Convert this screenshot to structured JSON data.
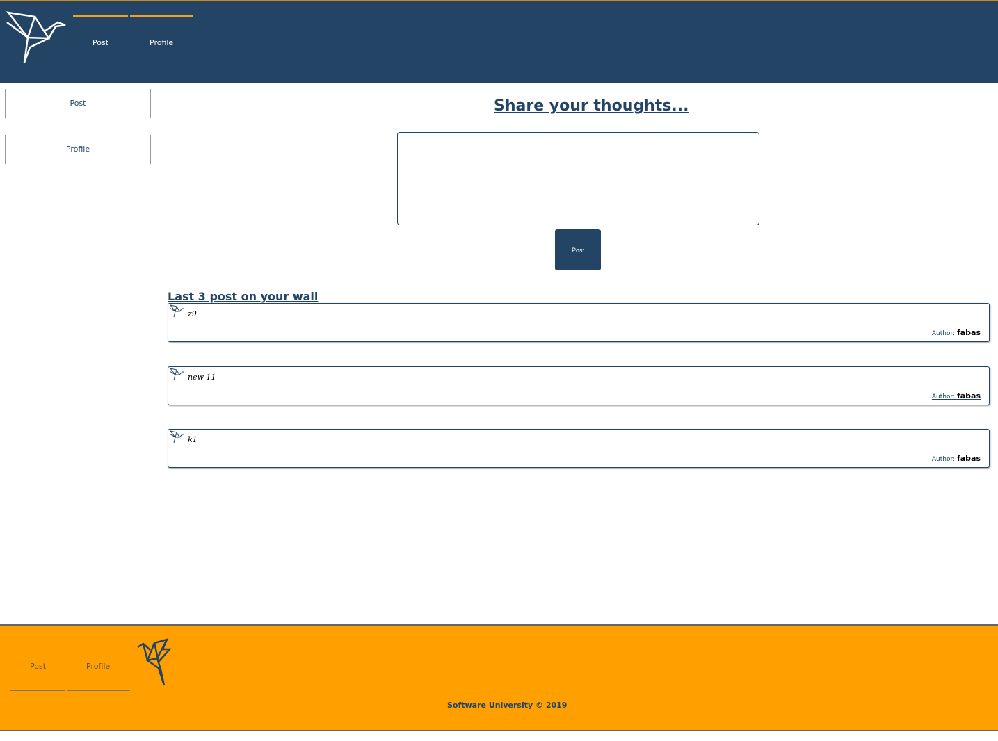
{
  "header": {
    "nav": [
      {
        "label": "Post"
      },
      {
        "label": "Profile"
      }
    ]
  },
  "sidebar": {
    "items": [
      {
        "label": "Post"
      },
      {
        "label": "Profile"
      }
    ]
  },
  "main": {
    "title": "Share your thoughts...",
    "textarea_value": "",
    "post_button": "Post",
    "wall_title": "Last 3 post on your wall",
    "posts": [
      {
        "text": "z9",
        "author_label": "Author:",
        "author": "fabas"
      },
      {
        "text": "new 11",
        "author_label": "Author:",
        "author": "fabas"
      },
      {
        "text": "k1",
        "author_label": "Author:",
        "author": "fabas"
      }
    ]
  },
  "footer": {
    "nav": [
      {
        "label": "Post"
      },
      {
        "label": "Profile"
      }
    ],
    "copyright": "Software University © 2019"
  },
  "colors": {
    "primary": "#234465",
    "accent": "#ff9f00"
  }
}
